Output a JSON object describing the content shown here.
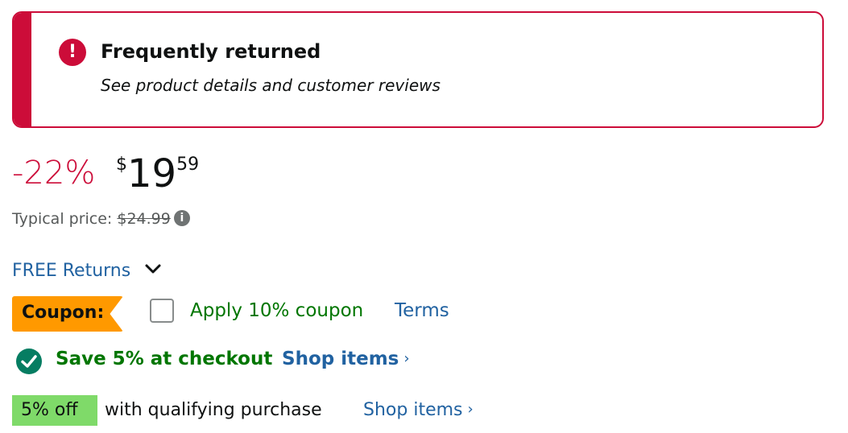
{
  "alert": {
    "title": "Frequently returned",
    "subtitle": "See product details and customer reviews",
    "icon": "exclamation-icon",
    "color": "#cc0c39"
  },
  "price": {
    "discount": "-22%",
    "symbol": "$",
    "whole": "19",
    "fraction": "59",
    "typical_label": "Typical price:",
    "typical_value": "$24.99"
  },
  "returns": {
    "label": "FREE Returns"
  },
  "coupon": {
    "badge": "Coupon:",
    "apply_label": "Apply 10% coupon",
    "terms_label": "Terms",
    "checked": false
  },
  "savings": {
    "text": "Save 5% at checkout",
    "link": "Shop items",
    "chevron": "›"
  },
  "offer": {
    "badge": "5% off",
    "text": "with qualifying purchase",
    "link": "Shop items",
    "chevron": "›"
  },
  "colors": {
    "deal_red": "#cc0c39",
    "link_blue": "#2162a1",
    "success_green": "#007600",
    "coupon_orange": "#ff9900",
    "badge_green": "#7fda69"
  }
}
